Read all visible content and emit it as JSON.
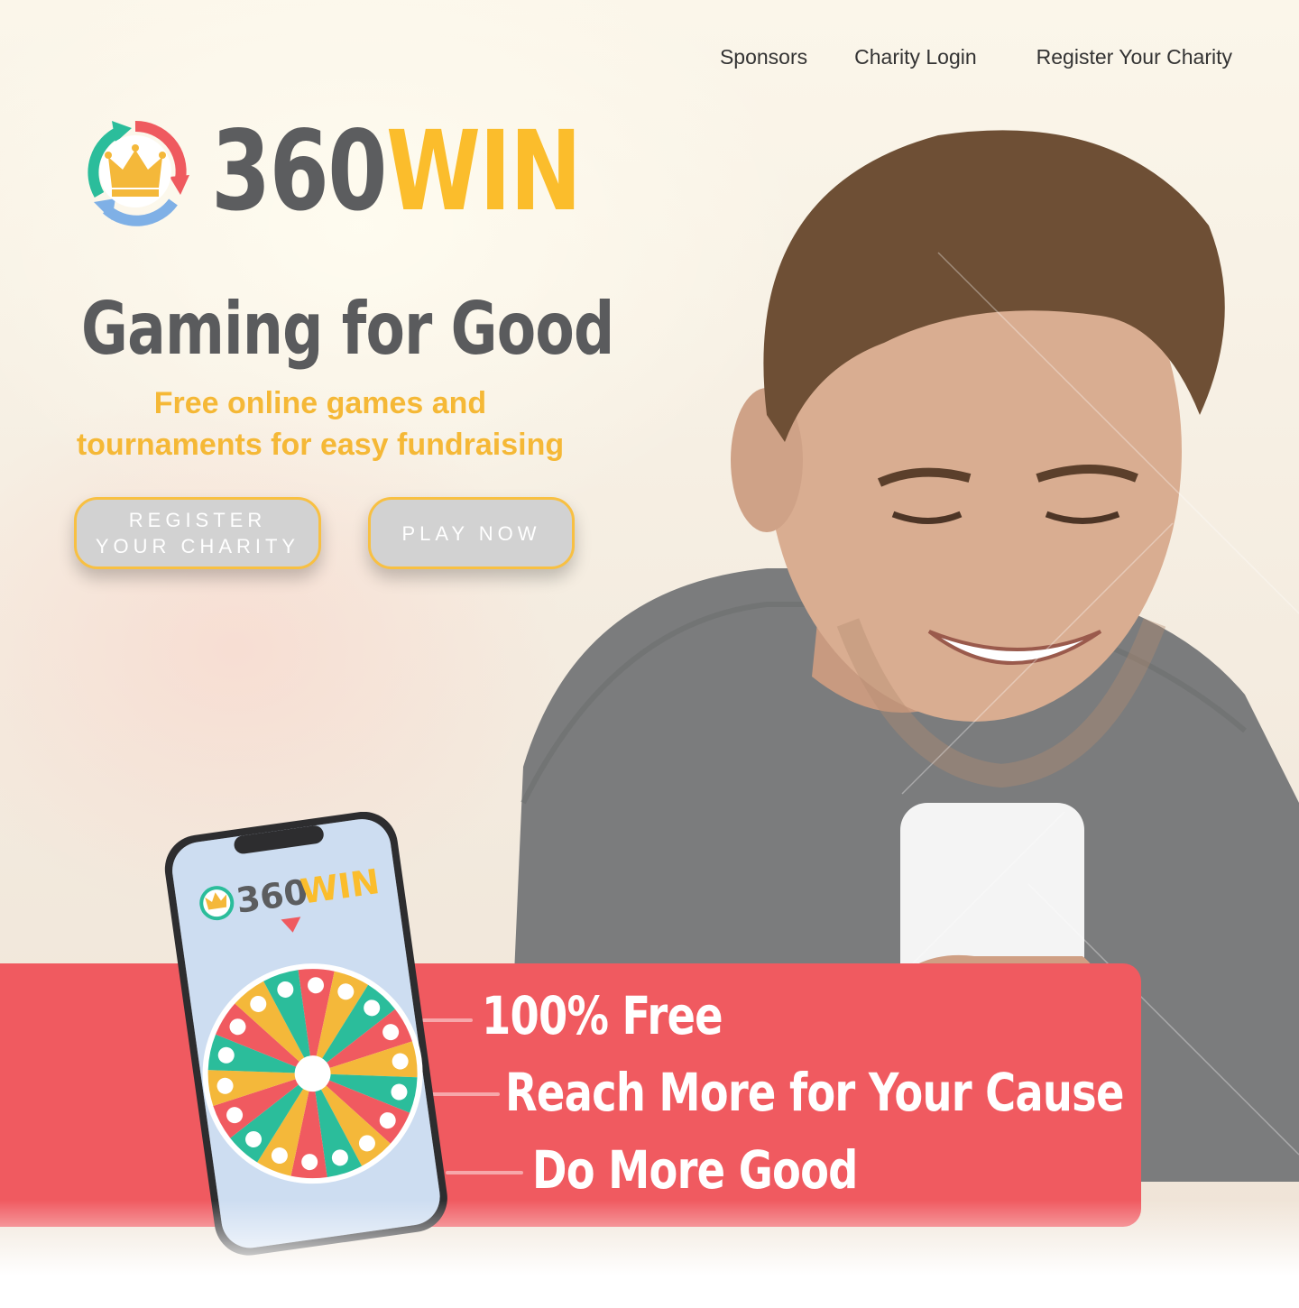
{
  "nav": {
    "sponsors": "Sponsors",
    "charity_login": "Charity Login",
    "register_charity": "Register Your Charity"
  },
  "brand": {
    "number": "360",
    "word": "WIN",
    "colors": {
      "grey": "#5c5d5f",
      "yellow": "#fbbd2c",
      "teal": "#2bbd9b",
      "red": "#f05a60",
      "blue": "#7fb0e6"
    }
  },
  "hero": {
    "headline": "Gaming for Good",
    "subline_line1": "Free online games and",
    "subline_line2": "tournaments for easy fundraising"
  },
  "buttons": {
    "register_line1": "REGISTER",
    "register_line2": "YOUR CHARITY",
    "play": "PLAY NOW"
  },
  "features": {
    "free": "100% Free",
    "reach": "Reach More for Your Cause",
    "good": "Do More Good"
  },
  "phone": {
    "logo_number": "360",
    "logo_word": "WIN"
  },
  "icons": {
    "logo_mark": "crown-circular-arrows-icon",
    "wheel": "prize-wheel-icon",
    "pointer": "triangle-pointer-icon"
  }
}
